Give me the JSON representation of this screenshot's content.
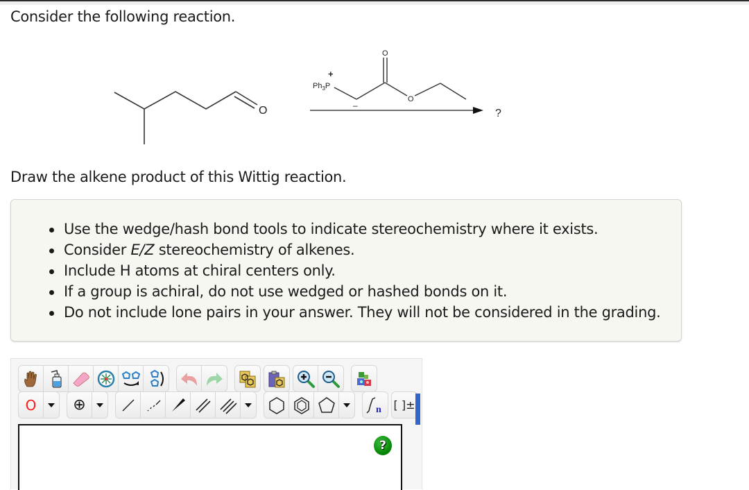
{
  "question": {
    "intro": "Consider the following reaction.",
    "prompt": "Draw the alkene product of this Wittig reaction."
  },
  "reaction": {
    "reactant_name": "4-methylpentanal",
    "reactant_label_O": "O",
    "reagent_name": "ethyl (triphenylphosphoranylidene)acetate ylide",
    "reagent_labels": {
      "ph3": "Ph",
      "ph3_sub": "3",
      "P": "P",
      "plus": "+",
      "minus": "–",
      "carbonyl_O": "O",
      "ester_O": "O"
    },
    "product": "?"
  },
  "instructions": {
    "items": [
      {
        "text": "Use the wedge/hash bond tools to indicate stereochemistry where it exists."
      },
      {
        "pre": "Consider ",
        "em": "E/Z",
        "post": " stereochemistry of alkenes."
      },
      {
        "text": "Include H atoms at chiral centers only."
      },
      {
        "text": "If a group is achiral, do not use wedged or hashed bonds on it."
      },
      {
        "text": "Do not include lone pairs in your answer. They will not be considered in the grading."
      }
    ]
  },
  "editor": {
    "toolbar_row1": [
      {
        "name": "hand-tool",
        "icon": "hand-icon"
      },
      {
        "name": "clean-tool",
        "icon": "wash-bottle-icon"
      },
      {
        "name": "erase-tool",
        "icon": "eraser-icon"
      },
      {
        "name": "center-tool",
        "icon": "snowflake-icon"
      },
      {
        "name": "flip-horizontal",
        "icon": "flip-horizontal-icon"
      },
      {
        "name": "flip-vertical",
        "icon": "flip-vertical-icon"
      },
      {
        "name": "undo",
        "icon": "undo-icon"
      },
      {
        "name": "redo",
        "icon": "redo-icon"
      },
      {
        "name": "copy",
        "icon": "copy-icon"
      },
      {
        "name": "paste",
        "icon": "paste-icon"
      },
      {
        "name": "zoom-in",
        "icon": "zoom-in-icon"
      },
      {
        "name": "zoom-out",
        "icon": "zoom-out-icon"
      },
      {
        "name": "templates",
        "icon": "templates-icon"
      }
    ],
    "toolbar_row2": {
      "atom_label": "O",
      "charge_label": "⊕",
      "sgroup_sub": "n",
      "bracket_label": "[ ]±"
    },
    "colors": {
      "atom_color": "#ff1a1a",
      "accent_bar": "#3366cc",
      "help_green": "#0a8a0a"
    },
    "help_label": "?"
  }
}
